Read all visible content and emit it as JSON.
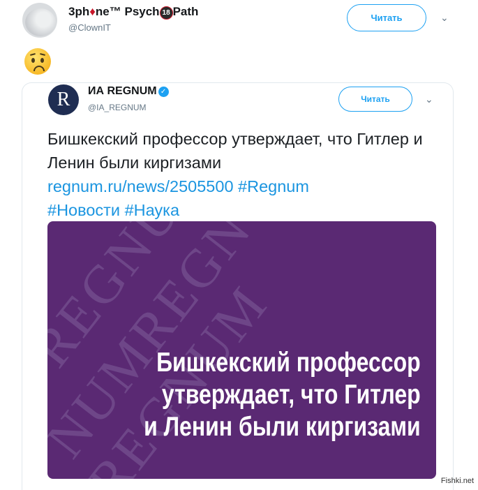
{
  "retweeter": {
    "name_part1": "3ph",
    "name_part2": "ne™ Psych",
    "name_badge": "18",
    "name_part3": "Path",
    "handle": "@ClownIT",
    "follow_label": "Читать"
  },
  "reaction_emoji": "😨",
  "quoted": {
    "name": "ИА REGNUM",
    "logo_letter": "R",
    "handle": "@IA_REGNUM",
    "follow_label": "Читать",
    "text": "Бишкекский профессор утверждает, что Гитлер и Ленин были киргизами",
    "link": "regnum.ru/news/2505500",
    "hashtags": [
      "#Regnum",
      "#Новости",
      "#Наука"
    ],
    "media": {
      "headline_lines": [
        "Бишкекский профессор",
        "утверждает, что Гитлер",
        "и Ленин были киргизами"
      ],
      "watermark_lines": [
        "REGNUM",
        "NUMREGNUM",
        "REGNUM"
      ],
      "background_color": "#5a2973"
    }
  },
  "site_watermark": "Fishki.net"
}
